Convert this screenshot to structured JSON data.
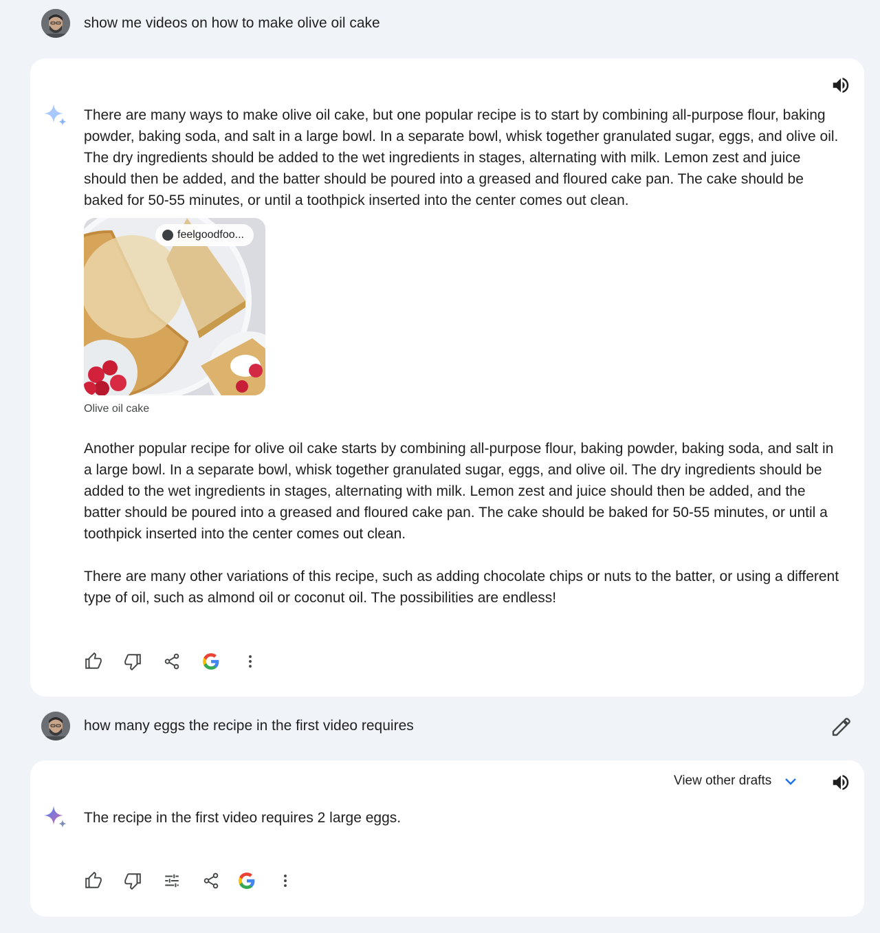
{
  "conversation": {
    "first_prompt": "show me videos on how to make olive oil cake",
    "first_response": {
      "paragraph_1": "There are many ways to make olive oil cake, but one popular recipe is to start by combining all-purpose flour, baking powder, baking soda, and salt in a large bowl. In a separate bowl, whisk together granulated sugar, eggs, and olive oil. The dry ingredients should be added to the wet ingredients in stages, alternating with milk. Lemon zest and juice should then be added, and the batter should be poured into a greased and floured cake pan. The cake should be baked for 50-55 minutes, or until a toothpick inserted into the center comes out clean.",
      "image": {
        "source_chip": "feelgoodfoo...",
        "caption": "Olive oil cake"
      },
      "paragraph_2": "Another popular recipe for olive oil cake starts by combining all-purpose flour, baking powder, baking soda, and salt in a large bowl. In a separate bowl, whisk together granulated sugar, eggs, and olive oil. The dry ingredients should be added to the wet ingredients in stages, alternating with milk. Lemon zest and juice should then be added, and the batter should be poured into a greased and floured cake pan. The cake should be baked for 50-55 minutes, or until a toothpick inserted into the center comes out clean.",
      "paragraph_3": "There are many other variations of this recipe, such as adding chocolate chips or nuts to the batter, or using a different type of oil, such as almond oil or coconut oil. The possibilities are endless!",
      "actions": [
        "thumbs-up-icon",
        "thumbs-down-icon",
        "share-icon",
        "google-icon",
        "more-vert-icon"
      ]
    },
    "second_prompt": "how many eggs the recipe in the first video requires",
    "second_response": {
      "view_drafts_label": "View other drafts",
      "text": "The recipe in the first video requires 2 large eggs.",
      "actions": [
        "thumbs-up-icon",
        "thumbs-down-icon",
        "tune-icon",
        "share-icon",
        "google-icon",
        "more-vert-icon"
      ]
    }
  },
  "colors": {
    "page_background": "#f0f4f9",
    "card_background": "#ffffff",
    "text": "#1f1f1f",
    "drafts_chevron": "#1a73e8",
    "spark_blue": "#4285f4",
    "spark_light": "#a8c7fa"
  }
}
